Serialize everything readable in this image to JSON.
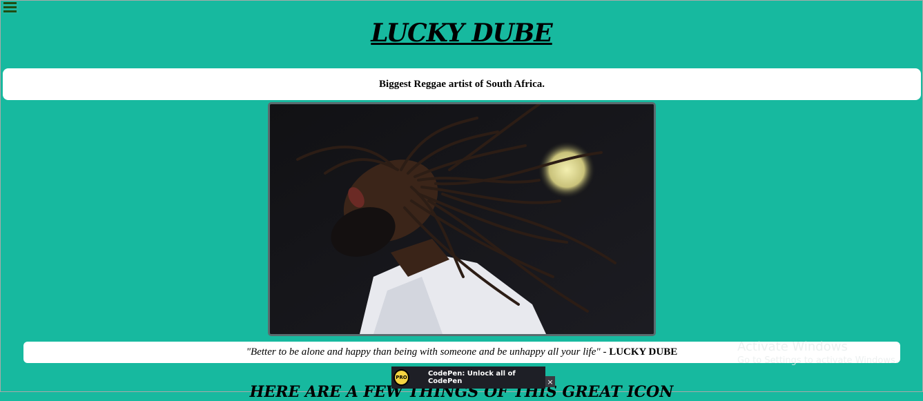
{
  "header": {
    "title": "LUCKY DUBE",
    "subtitle": "Biggest Reggae artist of South Africa."
  },
  "menu": {
    "icon": "hamburger-menu-icon"
  },
  "photo": {
    "alt": "Lucky Dube"
  },
  "quote": {
    "text": "\"Better to be alone and happy than being with someone and be unhappy all your life\"",
    "separator": " - ",
    "author": "LUCKY DUBE"
  },
  "next_section": {
    "heading": "HERE ARE A FEW THINGS OF THIS GREAT ICON"
  },
  "watermark": {
    "line1": "Activate Windows",
    "line2": "Go to Settings to activate Windows."
  },
  "codepen": {
    "badge": "PRO",
    "label": "CodePen: Unlock all of CodePen",
    "close": "×"
  },
  "colors": {
    "background": "#17b99f",
    "menu_bars": "#1f4d12",
    "banner": "#1e1f26"
  }
}
